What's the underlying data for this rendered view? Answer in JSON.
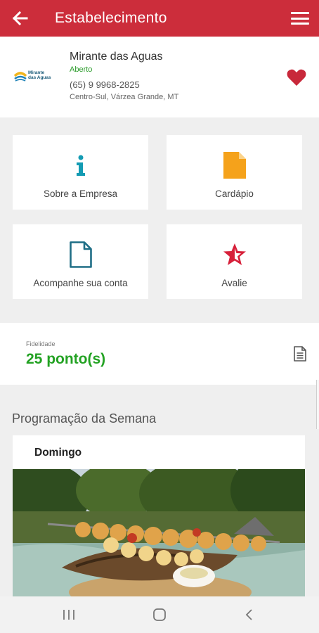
{
  "appbar": {
    "title": "Estabelecimento",
    "back_icon": "arrow-back-icon",
    "menu_icon": "hamburger-menu-icon",
    "color": "#cc2d3b"
  },
  "establishment": {
    "logo_text_line1": "Mirante",
    "logo_text_line2": "das Aguas",
    "name": "Mirante das Aguas",
    "status": "Aberto",
    "phone": "(65) 9 9968-2825",
    "address": "Centro-Sul, Várzea Grande, MT",
    "favorite_icon": "heart-icon",
    "favorited": true
  },
  "actions": [
    {
      "label": "Sobre a Empresa",
      "icon": "info-icon",
      "color": "#139bb3"
    },
    {
      "label": "Cardápio",
      "icon": "document-filled-icon",
      "color": "#f5a21b"
    },
    {
      "label": "Acompanhe sua conta",
      "icon": "document-outline-icon",
      "color": "#1f6e86"
    },
    {
      "label": "Avalie",
      "icon": "star-icon",
      "color": "#d7203a"
    }
  ],
  "fidelity": {
    "caption": "Fidelidade",
    "points": "25 ponto(s)",
    "icon": "receipt-icon"
  },
  "schedule": {
    "title": "Programação da Semana",
    "day": "Domingo",
    "image": "grilled-fish-photo"
  },
  "navbar": {
    "recents_icon": "recent-apps-icon",
    "home_icon": "home-icon",
    "back_icon": "nav-back-icon"
  }
}
